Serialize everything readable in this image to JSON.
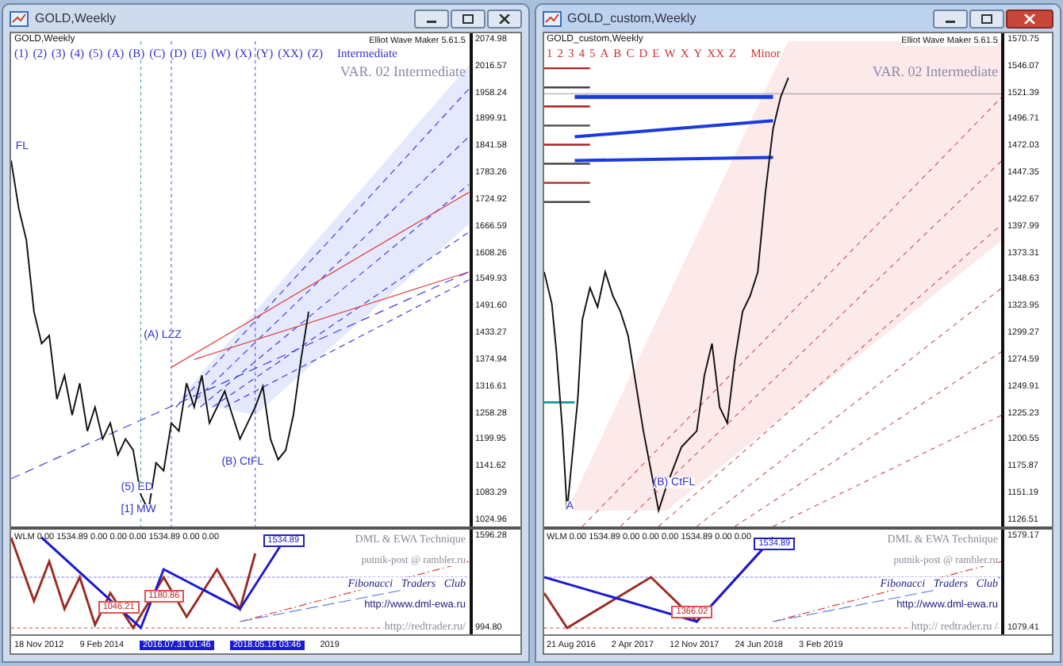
{
  "windows": [
    {
      "title": "GOLD,Weekly",
      "active": false,
      "chart": {
        "symbol_label": "GOLD,Weekly",
        "wave_labels": [
          "(1)",
          "(2)",
          "(3)",
          "(4)",
          "(5)",
          "(A)",
          "(B)",
          "(C)",
          "(D)",
          "(E)",
          "(W)",
          "(X)",
          "(Y)",
          "(XX)",
          "(Z)"
        ],
        "degree_label": "Intermediate",
        "indicator_name": "Elliot Wave Maker 5.61.5",
        "variant_label": "VAR. 02 Intermediate",
        "price_ticks": [
          "2074.98",
          "2016.57",
          "1958.24",
          "1899.91",
          "1841.58",
          "1783.26",
          "1724.92",
          "1666.59",
          "1608.26",
          "1549.93",
          "1491.60",
          "1433.27",
          "1374.94",
          "1316.61",
          "1258.28",
          "1199.95",
          "1141.62",
          "1083.29",
          "1024.96"
        ],
        "annotations": [
          "FL",
          "(A) LZZ",
          "(B) CtFL",
          "(5) ED",
          "[1] MW"
        ]
      },
      "oscillator": {
        "legend": "WLM 0.00 1534.89 0.00 0.00 0.00 1534.89 0.00 0.00",
        "price_tags": [
          "1534.89",
          "1046.21",
          "1180.86"
        ],
        "credits": [
          "DML & EWA Technique",
          "putnik-post @ rambler.ru",
          "Fibonacci   Traders   Club",
          "http://www.dml-ewa.ru",
          "http://redtrader.ru/"
        ],
        "price_ticks": [
          "1596.28",
          "994.80"
        ]
      },
      "time_labels": [
        {
          "kind": "date",
          "text": "18 Nov 2012"
        },
        {
          "kind": "date",
          "text": "9 Feb 2014"
        },
        {
          "kind": "cursor",
          "text": "2016.07.31 01:46"
        },
        {
          "kind": "cursor",
          "text": "2018.05.16 03:46"
        },
        {
          "kind": "date",
          "text": "2019"
        }
      ]
    },
    {
      "title": "GOLD_custom,Weekly",
      "active": true,
      "chart": {
        "symbol_label": "GOLD_custom,Weekly",
        "wave_labels": [
          "1",
          "2",
          "3",
          "4",
          "5",
          "A",
          "B",
          "C",
          "D",
          "E",
          "W",
          "X",
          "Y",
          "XX",
          "Z"
        ],
        "degree_label": "Minor",
        "indicator_name": "Elliot Wave Maker 5.61.5",
        "variant_label": "VAR. 02 Intermediate",
        "price_ticks": [
          "1570.75",
          "1546.07",
          "1521.39",
          "1496.71",
          "1472.03",
          "1447.35",
          "1422.67",
          "1397.99",
          "1373.31",
          "1348.63",
          "1323.95",
          "1299.27",
          "1274.59",
          "1249.91",
          "1225.23",
          "1200.55",
          "1175.87",
          "1151.19",
          "1126.51"
        ],
        "annotations": [
          "(B) CtFL",
          "A"
        ]
      },
      "oscillator": {
        "legend": "WLM 0.00 1534.89 0.00 0.00 0.00 1534.89 0.00 0.00",
        "price_tags": [
          "1534.89",
          "1366.02"
        ],
        "credits": [
          "DML & EWA Technique",
          "putnik-post @ rambler.ru",
          "Fibonacci   Traders   Club",
          "http://www.dml-ewa.ru",
          "http:// redtrader.ru /"
        ],
        "price_ticks": [
          "1579.17",
          "1079.41"
        ]
      },
      "time_labels": [
        {
          "kind": "date",
          "text": "21 Aug 2016"
        },
        {
          "kind": "date",
          "text": "2 Apr 2017"
        },
        {
          "kind": "date",
          "text": "12 Nov 2017"
        },
        {
          "kind": "date",
          "text": "24 Jun 2018"
        },
        {
          "kind": "date",
          "text": "3 Feb 2019"
        }
      ]
    }
  ]
}
